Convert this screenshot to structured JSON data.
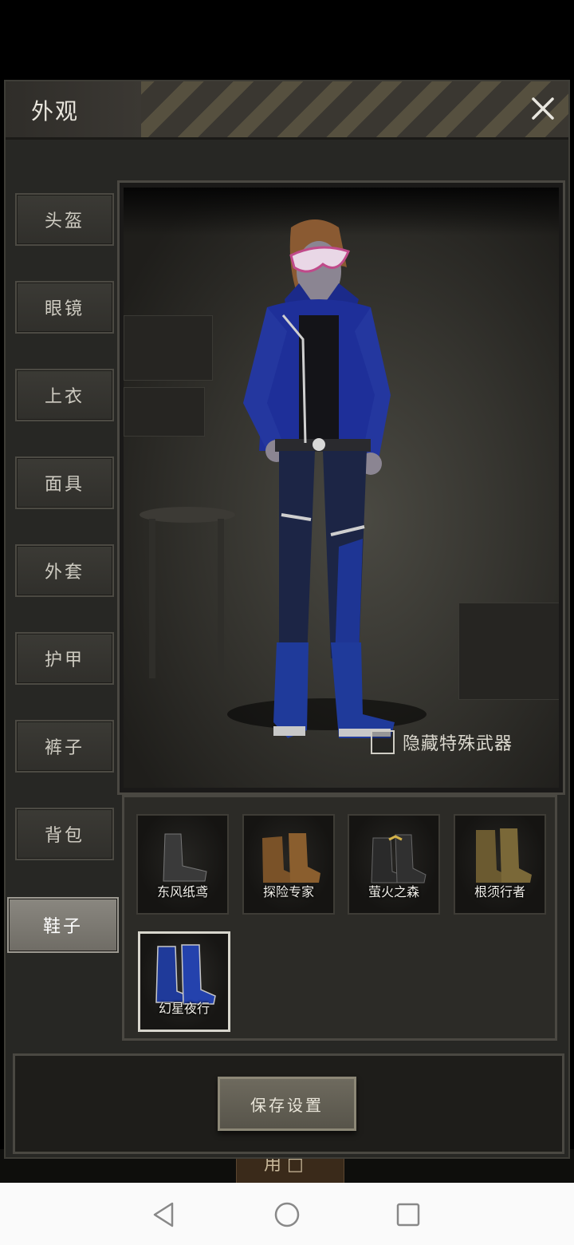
{
  "window": {
    "title": "外观"
  },
  "sidebar": {
    "tabs": [
      {
        "id": "helmet",
        "label": "头盔",
        "active": false
      },
      {
        "id": "glasses",
        "label": "眼镜",
        "active": false
      },
      {
        "id": "top",
        "label": "上衣",
        "active": false
      },
      {
        "id": "mask",
        "label": "面具",
        "active": false
      },
      {
        "id": "coat",
        "label": "外套",
        "active": false
      },
      {
        "id": "armor",
        "label": "护甲",
        "active": false
      },
      {
        "id": "pants",
        "label": "裤子",
        "active": false
      },
      {
        "id": "backpack",
        "label": "背包",
        "active": false
      },
      {
        "id": "shoes",
        "label": "鞋子",
        "active": true
      }
    ]
  },
  "preview": {
    "hide_weapon_label": "隐藏特殊武器",
    "hide_weapon_checked": false
  },
  "items": [
    {
      "name": "东风纸鸢",
      "selected": false,
      "color": "#3a3a3a"
    },
    {
      "name": "探险专家",
      "selected": false,
      "color": "#7a5228"
    },
    {
      "name": "萤火之森",
      "selected": false,
      "color": "#2a2a2a"
    },
    {
      "name": "根须行者",
      "selected": false,
      "color": "#6b5a30"
    },
    {
      "name": "幻星夜行",
      "selected": true,
      "color": "#1f3a9a"
    }
  ],
  "footer": {
    "save_label": "保存设置",
    "behind_text": "用 □"
  }
}
